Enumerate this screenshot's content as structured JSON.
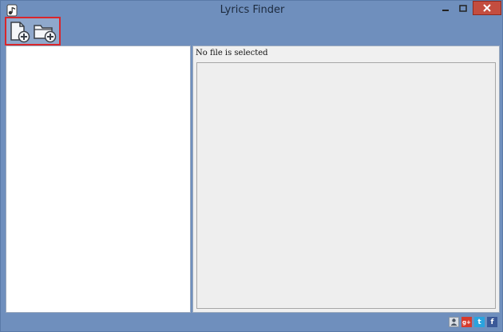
{
  "window": {
    "title": "Lyrics Finder"
  },
  "titlebar_buttons": {
    "minimize": "–",
    "maximize": "□",
    "close": "✕"
  },
  "toolbar": {
    "items": [
      {
        "name": "add-file-button",
        "icon": "add-file-icon"
      },
      {
        "name": "add-folder-button",
        "icon": "add-folder-icon"
      }
    ],
    "highlight_color": "#d9262c"
  },
  "right_panel": {
    "status": "No file is selected"
  },
  "footer": {
    "icons": [
      {
        "name": "user-icon",
        "glyph": ""
      },
      {
        "name": "google-plus-icon",
        "glyph": "g+"
      },
      {
        "name": "twitter-icon",
        "glyph": "t"
      },
      {
        "name": "facebook-icon",
        "glyph": "f"
      }
    ]
  },
  "colors": {
    "window_frame": "#6f8fbd",
    "close_button": "#c44d3f",
    "panel_bg": "#f0f0f0",
    "list_bg": "#ffffff"
  }
}
